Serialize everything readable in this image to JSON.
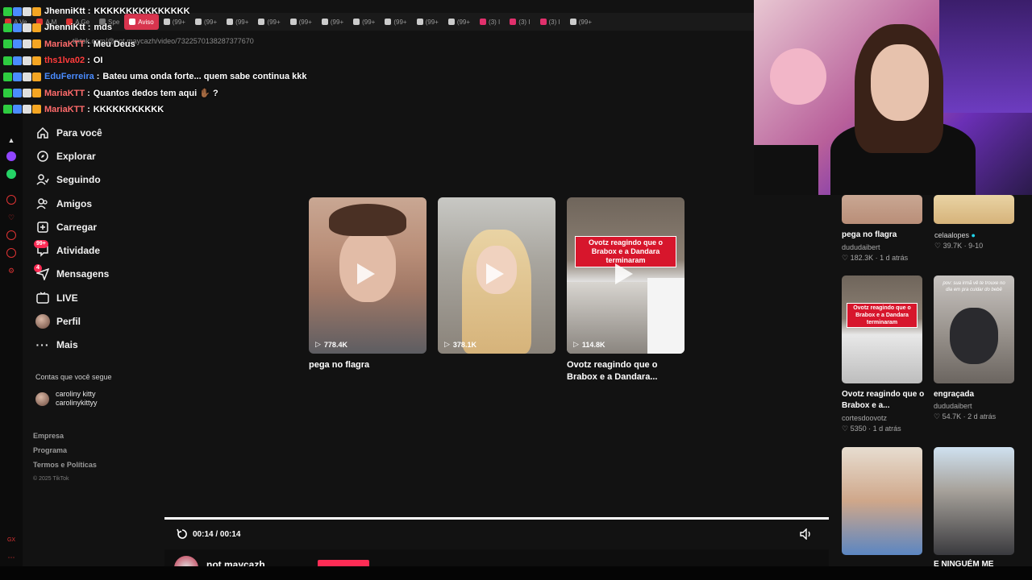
{
  "browser": {
    "tabs": [
      "A Ve",
      "A M",
      "A Ge",
      "Spe",
      "Aviso",
      "(99+",
      "(99+",
      "(99+",
      "(99+",
      "(99+",
      "(99+",
      "(99+",
      "(99+",
      "(99+",
      "(99+",
      "(3) I",
      "(3) I",
      "(3) I",
      "(99+"
    ],
    "active_tab_index": 4,
    "url": "tiktok.com/@not.maycazh/video/7322570138287377670"
  },
  "chat": [
    {
      "user": "JhenniKtt",
      "color": "#ffffff",
      "message": "KKKKKKKKKKKKKKK"
    },
    {
      "user": "JhenniKtt",
      "color": "#ffffff",
      "message": "mds"
    },
    {
      "user": "MariaKTT",
      "color": "#ff6b6b",
      "message": "Meu Deus"
    },
    {
      "user": "ths1lva02",
      "color": "#ff3b3b",
      "message": "OI"
    },
    {
      "user": "EduFerreira",
      "color": "#4a8cff",
      "message": "Bateu uma onda forte... quem sabe continua kkk"
    },
    {
      "user": "MariaKTT",
      "color": "#ff6b6b",
      "message": "Quantos dedos tem aqui ✋🏾 ?"
    },
    {
      "user": "MariaKTT",
      "color": "#ff6b6b",
      "message": "KKKKKKKKKKK"
    }
  ],
  "nav": {
    "items": [
      {
        "label": "Para você",
        "icon": "home-icon"
      },
      {
        "label": "Explorar",
        "icon": "compass-icon"
      },
      {
        "label": "Seguindo",
        "icon": "following-icon"
      },
      {
        "label": "Amigos",
        "icon": "friends-icon"
      },
      {
        "label": "Carregar",
        "icon": "upload-icon"
      },
      {
        "label": "Atividade",
        "icon": "activity-icon",
        "badge": "99+"
      },
      {
        "label": "Mensagens",
        "icon": "messages-icon",
        "badge": "4"
      },
      {
        "label": "LIVE",
        "icon": "live-icon"
      },
      {
        "label": "Perfil",
        "icon": "profile-avatar"
      },
      {
        "label": "Mais",
        "icon": "more-icon"
      }
    ],
    "following_title": "Contas que você segue",
    "following": [
      {
        "name": "caroliny kitty",
        "handle": "carolinykittyy"
      }
    ],
    "footer": [
      "Empresa",
      "Programa",
      "Termos e Políticas"
    ],
    "copyright": "© 2025 TikTok"
  },
  "grid": [
    {
      "views": "778.4K",
      "title": "pega no flagra"
    },
    {
      "views": "378.1K",
      "title": ""
    },
    {
      "views": "114.8K",
      "title": "Ovotz reagindo que o Brabox e a Dandara...",
      "overlay": "Ovotz reagindo que o Brabox e a Dandara terminaram"
    }
  ],
  "player": {
    "progress": 1.0,
    "time": "00:14 / 00:14",
    "author": "not.maycazh"
  },
  "related": [
    {
      "title": "pega no flagra",
      "author": "dududaibert",
      "likes": "182.3K",
      "date": "1 d atrás"
    },
    {
      "title": "",
      "author": "celaalopes",
      "likes": "39.7K",
      "date": "9-10",
      "verified": true
    },
    {
      "title": "Ovotz reagindo que o Brabox e a...",
      "author": "cortesdoovotz",
      "likes": "5350",
      "date": "1 d atrás",
      "overlay": "Ovotz reagindo que o Brabox e a Dandara terminaram"
    },
    {
      "title": "engraçada",
      "author": "dududaibert",
      "likes": "54.7K",
      "date": "2 d atrás",
      "overlay": "pov: sua irmã vê te trouxe no dia em pra cuidar do bebê"
    },
    {
      "title": "",
      "author": "",
      "likes": "",
      "date": ""
    },
    {
      "title": "E NINGUÉM ME",
      "author": "",
      "likes": "",
      "date": ""
    }
  ],
  "colors": {
    "accent": "#fe2c55",
    "background": "#121212"
  }
}
